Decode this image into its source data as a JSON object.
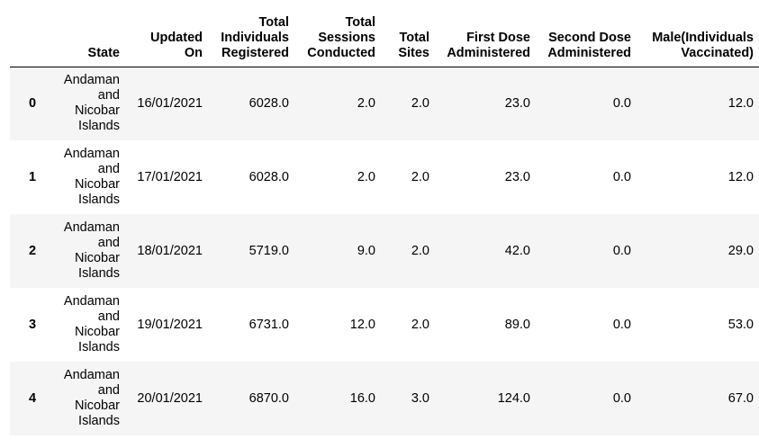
{
  "table": {
    "columns": [
      "",
      "State",
      "Updated On",
      "Total Individuals Registered",
      "Total Sessions Conducted",
      "Total Sites",
      "First Dose Administered",
      "Second Dose Administered",
      "Male(Individuals Vaccinated)"
    ],
    "rows": [
      {
        "index": "0",
        "state": "Andaman and Nicobar Islands",
        "updated_on": "16/01/2021",
        "registered": "6028.0",
        "sessions": "2.0",
        "sites": "2.0",
        "first_dose": "23.0",
        "second_dose": "0.0",
        "male": "12.0"
      },
      {
        "index": "1",
        "state": "Andaman and Nicobar Islands",
        "updated_on": "17/01/2021",
        "registered": "6028.0",
        "sessions": "2.0",
        "sites": "2.0",
        "first_dose": "23.0",
        "second_dose": "0.0",
        "male": "12.0"
      },
      {
        "index": "2",
        "state": "Andaman and Nicobar Islands",
        "updated_on": "18/01/2021",
        "registered": "5719.0",
        "sessions": "9.0",
        "sites": "2.0",
        "first_dose": "42.0",
        "second_dose": "0.0",
        "male": "29.0"
      },
      {
        "index": "3",
        "state": "Andaman and Nicobar Islands",
        "updated_on": "19/01/2021",
        "registered": "6731.0",
        "sessions": "12.0",
        "sites": "2.0",
        "first_dose": "89.0",
        "second_dose": "0.0",
        "male": "53.0"
      },
      {
        "index": "4",
        "state": "Andaman and Nicobar Islands",
        "updated_on": "20/01/2021",
        "registered": "6870.0",
        "sessions": "16.0",
        "sites": "3.0",
        "first_dose": "124.0",
        "second_dose": "0.0",
        "male": "67.0"
      }
    ]
  }
}
